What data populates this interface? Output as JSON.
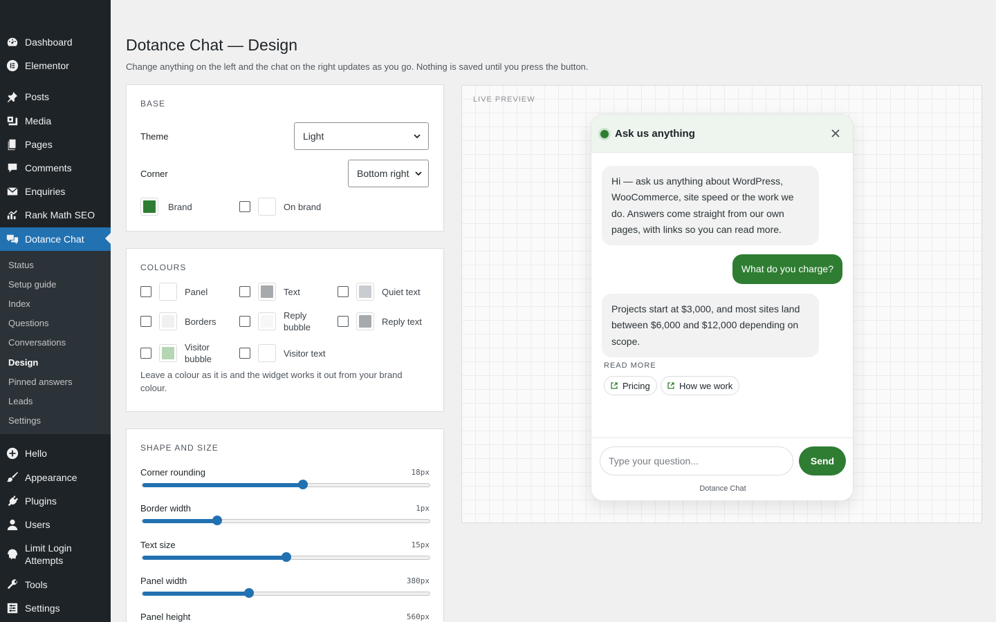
{
  "admin_menu": {
    "items": [
      {
        "label": "Dashboard",
        "icon": "dashboard-icon"
      },
      {
        "label": "Elementor",
        "icon": "elementor-icon"
      },
      {
        "label": "Posts",
        "icon": "pin-icon"
      },
      {
        "label": "Media",
        "icon": "media-icon"
      },
      {
        "label": "Pages",
        "icon": "pages-icon"
      },
      {
        "label": "Comments",
        "icon": "comment-icon"
      },
      {
        "label": "Enquiries",
        "icon": "mail-icon"
      },
      {
        "label": "Rank Math SEO",
        "icon": "chart-icon"
      },
      {
        "label": "Dotance Chat",
        "icon": "chat-icon"
      },
      {
        "label": "Hello",
        "icon": "plus-circle-icon"
      },
      {
        "label": "Appearance",
        "icon": "brush-icon"
      },
      {
        "label": "Plugins",
        "icon": "plug-icon"
      },
      {
        "label": "Users",
        "icon": "user-icon"
      },
      {
        "label": "Limit Login\nAttempts",
        "icon": "fingerprint-icon"
      },
      {
        "label": "Tools",
        "icon": "wrench-icon"
      },
      {
        "label": "Settings",
        "icon": "settings-icon"
      }
    ],
    "submenu": [
      "Status",
      "Setup guide",
      "Index",
      "Questions",
      "Conversations",
      "Design",
      "Pinned answers",
      "Leads",
      "Settings"
    ],
    "active_item": "Dotance Chat",
    "active_subitem": "Design"
  },
  "header": {
    "title": "Dotance Chat — Design",
    "description": "Change anything on the left and the chat on the right updates as you go. Nothing is saved until you press the button."
  },
  "base": {
    "title": "BASE",
    "theme_label": "Theme",
    "theme_value": "Light",
    "corner_label": "Corner",
    "corner_value": "Bottom right",
    "brand_label": "Brand",
    "brand_color": "#2e7d32",
    "on_brand_label": "On brand",
    "on_brand_color": "#ffffff"
  },
  "colours": {
    "title": "COLOURS",
    "items": [
      {
        "label": "Panel",
        "color": "#ffffff"
      },
      {
        "label": "Text",
        "color": "#a7aaad"
      },
      {
        "label": "Quiet text",
        "color": "#c9ccd1"
      },
      {
        "label": "Borders",
        "color": "#f0f0f1"
      },
      {
        "label": "Reply\nbubble",
        "color": "#f6f7f7"
      },
      {
        "label": "Reply text",
        "color": "#a7aaad"
      },
      {
        "label": "Visitor\nbubble",
        "color": "#b5d6b3"
      },
      {
        "label": "Visitor text",
        "color": "#ffffff"
      }
    ],
    "help": "Leave a colour as it is and the widget works it out from your brand colour."
  },
  "shape": {
    "title": "SHAPE AND SIZE",
    "sliders": [
      {
        "label": "Corner rounding",
        "value": "18px",
        "fraction": 0.56
      },
      {
        "label": "Border width",
        "value": "1px",
        "fraction": 0.26
      },
      {
        "label": "Text size",
        "value": "15px",
        "fraction": 0.5
      },
      {
        "label": "Panel width",
        "value": "380px",
        "fraction": 0.37
      },
      {
        "label": "Panel height",
        "value": "560px",
        "fraction": 0.5
      }
    ]
  },
  "preview": {
    "label": "LIVE PREVIEW",
    "chat_title": "Ask us anything",
    "bot_message_1": "Hi — ask us anything about WordPress, WooCommerce, site speed or the work we do. Answers come straight from our own pages, with links so you can read more.",
    "user_message": "What do you charge?",
    "bot_message_2": "Projects start at $3,000, and most sites land between $6,000 and $12,000 depending on scope.",
    "read_more": "READ MORE",
    "links": [
      "Pricing",
      "How we work"
    ],
    "input_placeholder": "Type your question...",
    "send_label": "Send",
    "branding": "Dotance Chat"
  },
  "colors": {
    "admin_sidebar": "#1d2327",
    "admin_accent": "#2271b1",
    "brand": "#2e7d32"
  }
}
